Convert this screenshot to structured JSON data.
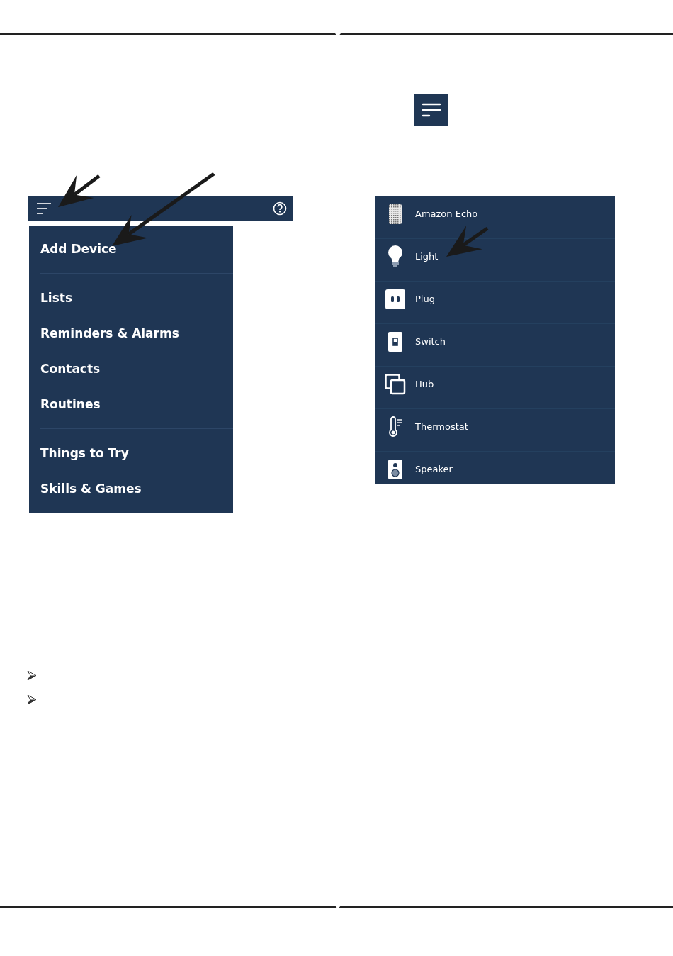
{
  "menu_screen": {
    "top_bar": {
      "kind": "app-bar"
    },
    "sections": [
      {
        "items": [
          {
            "label": "Add Device"
          }
        ]
      },
      {
        "items": [
          {
            "label": "Lists"
          },
          {
            "label": "Reminders & Alarms"
          },
          {
            "label": "Contacts"
          },
          {
            "label": "Routines"
          }
        ]
      },
      {
        "items": [
          {
            "label": "Things to Try"
          },
          {
            "label": "Skills & Games"
          }
        ]
      }
    ]
  },
  "menu_button": {
    "kind": "hamburger"
  },
  "device_list": {
    "items": [
      {
        "label": "Amazon Echo",
        "kind": "echo"
      },
      {
        "label": "Light",
        "kind": "light"
      },
      {
        "label": "Plug",
        "kind": "plug"
      },
      {
        "label": "Switch",
        "kind": "switch"
      },
      {
        "label": "Hub",
        "kind": "hub"
      },
      {
        "label": "Thermostat",
        "kind": "thermostat"
      },
      {
        "label": "Speaker",
        "kind": "speaker"
      }
    ]
  },
  "bullets": [
    {
      "kind": "arrow"
    },
    {
      "kind": "arrow"
    }
  ]
}
